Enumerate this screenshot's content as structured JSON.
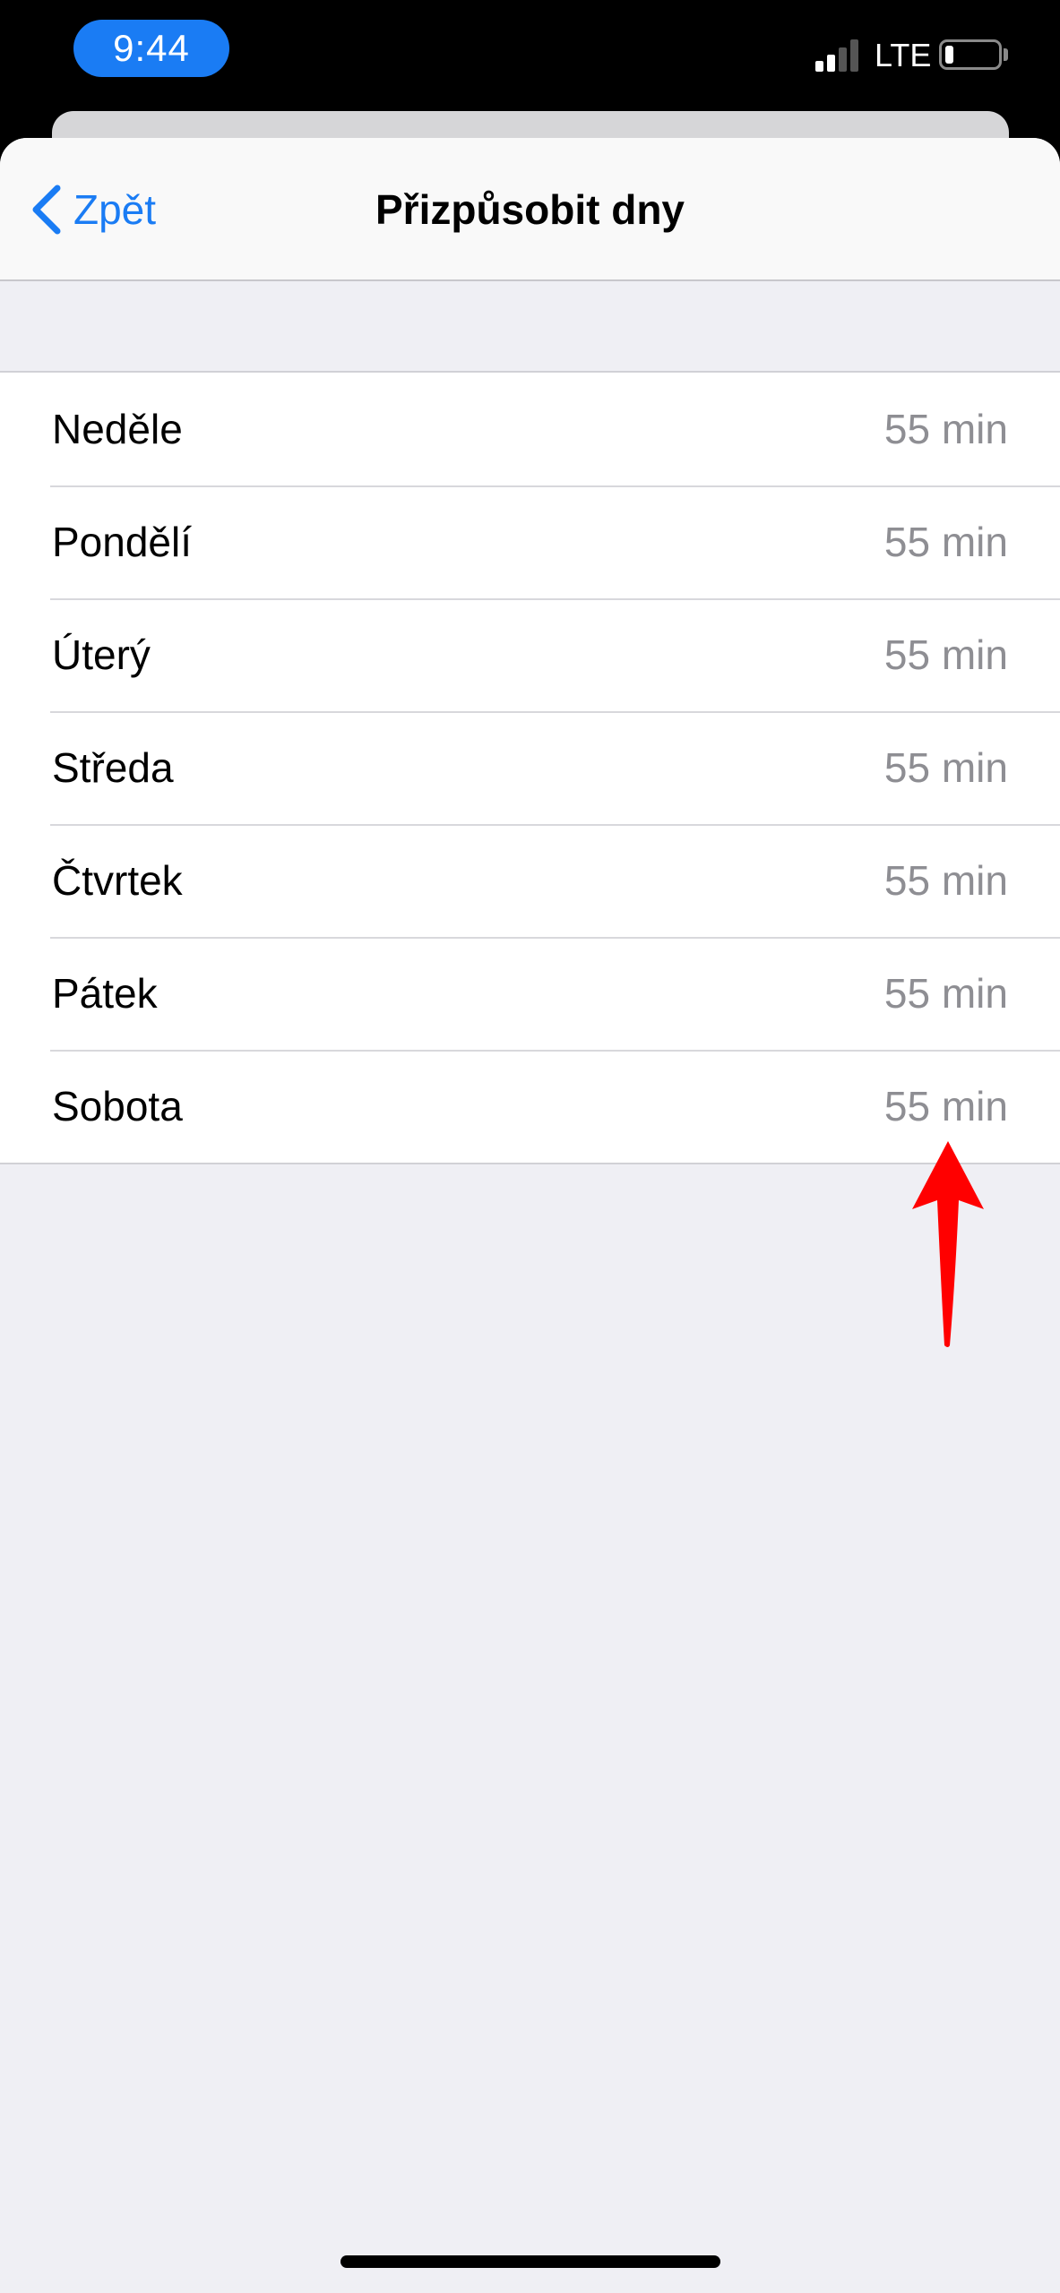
{
  "status_bar": {
    "time": "9:44",
    "network": "LTE",
    "colors": {
      "time_pill": "#1a7cf4"
    }
  },
  "nav": {
    "back_label": "Zpět",
    "title": "Přizpůsobit dny",
    "back_icon": "chevron-left-icon",
    "accent": "#1a7cf4"
  },
  "days": [
    {
      "label": "Neděle",
      "value": "55 min"
    },
    {
      "label": "Pondělí",
      "value": "55 min"
    },
    {
      "label": "Úterý",
      "value": "55 min"
    },
    {
      "label": "Středa",
      "value": "55 min"
    },
    {
      "label": "Čtvrtek",
      "value": "55 min"
    },
    {
      "label": "Pátek",
      "value": "55 min"
    },
    {
      "label": "Sobota",
      "value": "55 min"
    }
  ],
  "annotation": {
    "icon": "red-arrow-icon",
    "color": "#ff0000"
  }
}
